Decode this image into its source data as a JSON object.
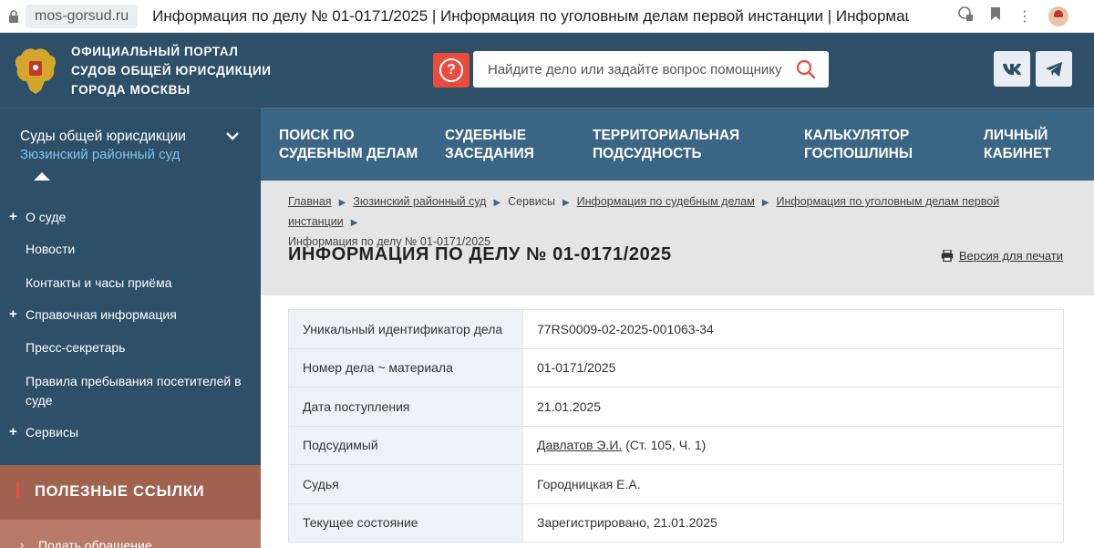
{
  "browser": {
    "url": "mos-gorsud.ru",
    "tab_title": "Информация по делу № 01-0171/2025 | Информация по уголовным делам первой инстанции | Информац..."
  },
  "header": {
    "portal_title_lines": [
      "ОФИЦИАЛЬНЫЙ ПОРТАЛ",
      "СУДОВ ОБЩЕЙ ЮРИСДИКЦИИ",
      "ГОРОДА МОСКВЫ"
    ],
    "help_label": "?",
    "search_placeholder": "Найдите дело или задайте вопрос помощнику",
    "social": [
      "VK",
      "telegram"
    ]
  },
  "court_select": {
    "label": "Суды общей юрисдикции",
    "current": "Зюзинский районный суд"
  },
  "main_menu": [
    {
      "line1": "ПОИСК ПО",
      "line2": "СУДЕБНЫМ ДЕЛАМ"
    },
    {
      "line1": "СУДЕБНЫЕ",
      "line2": "ЗАСЕДАНИЯ"
    },
    {
      "line1": "ТЕРРИТОРИАЛЬНАЯ",
      "line2": "ПОДСУДНОСТЬ"
    },
    {
      "line1": "КАЛЬКУЛЯТОР",
      "line2": "ГОСПОШЛИНЫ"
    },
    {
      "line1": "ЛИЧНЫЙ",
      "line2": "КАБИНЕТ"
    }
  ],
  "sidebar": {
    "items": [
      {
        "label": "О суде",
        "plus": true
      },
      {
        "label": "Новости",
        "plus": false
      },
      {
        "label": "Контакты и часы приёма",
        "plus": false
      },
      {
        "label": "Справочная информация",
        "plus": true
      },
      {
        "label": "Пресс-секретарь",
        "plus": false
      },
      {
        "label": "Правила пребывания посетителей в суде",
        "plus": false
      },
      {
        "label": "Сервисы",
        "plus": true
      }
    ],
    "useful_title": "ПОЛЕЗНЫЕ ССЫЛКИ",
    "useful_first": "Подать обращение"
  },
  "breadcrumbs": [
    "Главная",
    "Зюзинский районный суд",
    "Сервисы",
    "Информация по судебным делам",
    "Информация по уголовным делам первой инстанции",
    "Информация по делу № 01-0171/2025"
  ],
  "page_title": "ИНФОРМАЦИЯ ПО ДЕЛУ № 01-0171/2025",
  "print_label": "Версия для печати",
  "case_info": [
    {
      "key": "Уникальный идентификатор дела",
      "value": "77RS0009-02-2025-001063-34"
    },
    {
      "key": "Номер дела ~ материала",
      "value": "01-0171/2025"
    },
    {
      "key": "Дата поступления",
      "value": "21.01.2025"
    },
    {
      "key": "Подсудимый",
      "value": "Давлатов Э.И.",
      "value_extra": " (Ст. 105, Ч. 1)"
    },
    {
      "key": "Судья",
      "value": "Городницкая Е.А."
    },
    {
      "key": "Текущее состояние",
      "value": "Зарегистрировано, 21.01.2025"
    }
  ]
}
